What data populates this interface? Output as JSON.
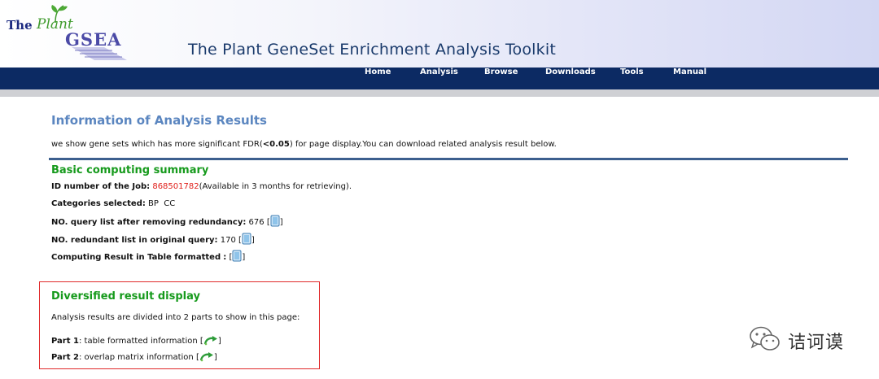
{
  "logo": {
    "the": "The",
    "plant": "Plant",
    "gsea": "GSEA"
  },
  "site_title": "The Plant GeneSet Enrichment Analysis Toolkit",
  "nav": {
    "items": [
      "Home",
      "Analysis",
      "Browse",
      "Downloads",
      "Tools",
      "Manual"
    ]
  },
  "main": {
    "title": "Information of Analysis Results",
    "intro_before": "we show gene sets which has more significant FDR(",
    "intro_threshold": "<0.05",
    "intro_after": ") for page display.You can download related analysis result below."
  },
  "summary": {
    "title": "Basic computing summary",
    "job_label": "ID number of the Job",
    "job_id": "868501782",
    "job_note": "(Available in 3 months for retrieving).",
    "categories_label": "Categories selected",
    "categories_value": "BP  CC",
    "query_label": "NO. query list after removing redundancy",
    "query_value": "676",
    "redundant_label": "NO. redundant list in original query",
    "redundant_value": "170",
    "table_label": "Computing Result in Table formatted",
    "table_value": ""
  },
  "diversified": {
    "title": "Diversified result display",
    "description": "Analysis results are divided into 2 parts to show in this page:",
    "part1_label": "Part 1",
    "part1_text": "table formatted information",
    "part2_label": "Part 2",
    "part2_text": "overlap matrix information"
  },
  "watermark": {
    "text": "诘诃谟"
  },
  "icons": {
    "download": "download-icon",
    "jump": "jump-arrow-icon",
    "wechat": "wechat-icon"
  },
  "colors": {
    "nav_bg": "#0c2a63",
    "title_blue": "#5b86c0",
    "section_green": "#169a1c",
    "job_red": "#e0201b",
    "highlight_box": "#e0292a"
  }
}
